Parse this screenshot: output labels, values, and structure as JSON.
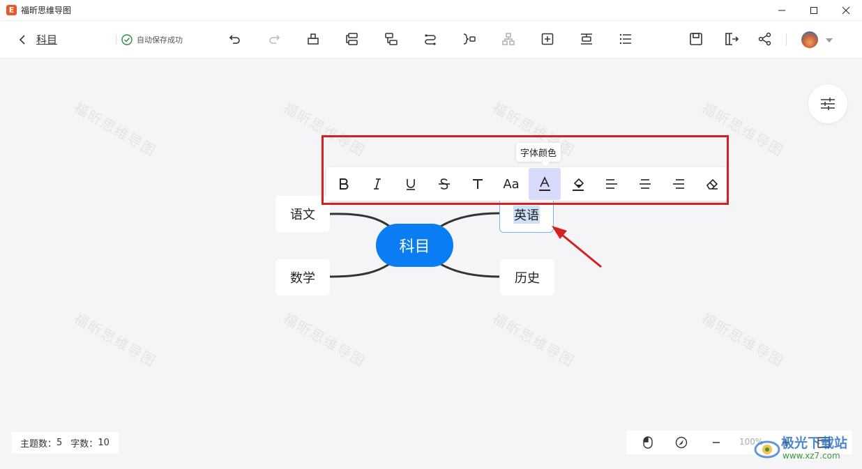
{
  "window": {
    "app_title": "福昕思维导图",
    "app_logo_letter": "E"
  },
  "toolbar": {
    "doc_title": "科目",
    "save_status": "自动保存成功",
    "tools": [
      "undo-icon",
      "redo-icon",
      "insert-topic-icon",
      "insert-child-icon",
      "insert-sibling-icon",
      "connection-icon",
      "summary-icon",
      "structure-icon",
      "insert-icon",
      "boundary-icon",
      "outline-icon"
    ],
    "right_tools": [
      "save-icon",
      "export-icon",
      "share-icon"
    ]
  },
  "watermark_text": "福昕思维导图",
  "mindmap": {
    "root": "科目",
    "nodes": [
      "语文",
      "数学",
      "英语",
      "历史"
    ],
    "selected_node": "英语"
  },
  "format_toolbar": {
    "tooltip": "字体颜色",
    "buttons": [
      {
        "icon": "bold-icon",
        "label": "B"
      },
      {
        "icon": "italic-icon",
        "label": "I"
      },
      {
        "icon": "underline-icon",
        "label": "U"
      },
      {
        "icon": "strikethrough-icon",
        "label": "S"
      },
      {
        "icon": "text-style-icon",
        "label": "T"
      },
      {
        "icon": "font-size-icon",
        "label": "Aa"
      },
      {
        "icon": "font-color-icon",
        "label": "A",
        "active": true
      },
      {
        "icon": "highlight-icon",
        "label": ""
      },
      {
        "icon": "align-left-icon",
        "label": ""
      },
      {
        "icon": "align-center-icon",
        "label": ""
      },
      {
        "icon": "align-right-icon",
        "label": ""
      },
      {
        "icon": "clear-format-icon",
        "label": ""
      }
    ]
  },
  "status_bar": {
    "topic_count_label": "主题数：",
    "topic_count": "5",
    "word_count_label": "字数：",
    "word_count": "10",
    "zoom": "100%"
  },
  "site_watermark": {
    "line1": "极光下载站",
    "line2": "www.xz7.com"
  },
  "colors": {
    "root_node": "#0a7cf4",
    "highlight_frame": "#d42020",
    "active_button": "#d8dbfb",
    "arrow": "#d42020"
  }
}
